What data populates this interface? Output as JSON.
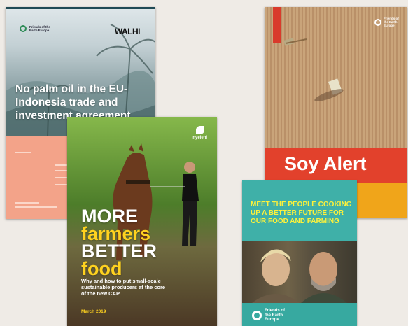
{
  "covers": {
    "palm_oil": {
      "title": "No palm oil in the EU-Indonesia trade and investment agreement",
      "partner_logo": "WALHI",
      "org_logo": "Friends of the Earth Europe"
    },
    "farmers": {
      "logo": "nyeleni",
      "title_line1": "MORE",
      "title_line2": "farmers",
      "title_line3": "BETTER",
      "title_line4": "food",
      "subtitle": "Why and how to put small-scale sustainable producers at the core of the new CAP",
      "date": "March 2019"
    },
    "soy": {
      "title": "Soy Alert",
      "org_logo": "Friends of the Earth Europe"
    },
    "people": {
      "title": "MEET THE PEOPLE COOKING UP A BETTER FUTURE FOR OUR FOOD AND FARMING",
      "org_logo": "Friends of the Earth Europe"
    }
  },
  "colors": {
    "background": "#efebe6",
    "salmon": "#f3a389",
    "farmers_yellow": "#ffd21f",
    "soy_red": "#e2412c",
    "soy_orange": "#f0a51a",
    "people_teal": "#3fb0a8",
    "people_yellow": "#fff23a"
  }
}
